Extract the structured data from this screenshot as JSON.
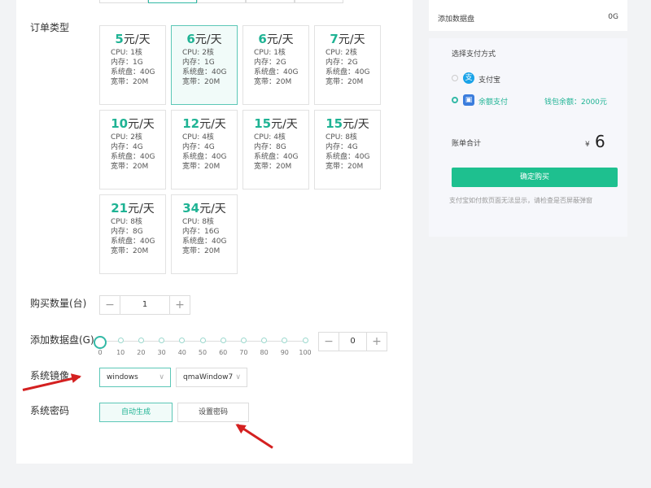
{
  "order_type_label": "订单类型",
  "plans": [
    {
      "price": "5",
      "unit": "元/天",
      "cpu": "CPU: 1核",
      "mem": "内存：1G",
      "disk": "系统盘：40G",
      "bw": "宽带：20M",
      "selected": false
    },
    {
      "price": "6",
      "unit": "元/天",
      "cpu": "CPU: 2核",
      "mem": "内存：1G",
      "disk": "系统盘：40G",
      "bw": "宽带：20M",
      "selected": true
    },
    {
      "price": "6",
      "unit": "元/天",
      "cpu": "CPU: 1核",
      "mem": "内存：2G",
      "disk": "系统盘：40G",
      "bw": "宽带：20M",
      "selected": false
    },
    {
      "price": "7",
      "unit": "元/天",
      "cpu": "CPU: 2核",
      "mem": "内存：2G",
      "disk": "系统盘：40G",
      "bw": "宽带：20M",
      "selected": false
    },
    {
      "price": "10",
      "unit": "元/天",
      "cpu": "CPU: 2核",
      "mem": "内存：4G",
      "disk": "系统盘：40G",
      "bw": "宽带：20M",
      "selected": false
    },
    {
      "price": "12",
      "unit": "元/天",
      "cpu": "CPU: 4核",
      "mem": "内存：4G",
      "disk": "系统盘：40G",
      "bw": "宽带：20M",
      "selected": false
    },
    {
      "price": "15",
      "unit": "元/天",
      "cpu": "CPU: 4核",
      "mem": "内存：8G",
      "disk": "系统盘：40G",
      "bw": "宽带：20M",
      "selected": false
    },
    {
      "price": "15",
      "unit": "元/天",
      "cpu": "CPU: 8核",
      "mem": "内存：4G",
      "disk": "系统盘：40G",
      "bw": "宽带：20M",
      "selected": false
    },
    {
      "price": "21",
      "unit": "元/天",
      "cpu": "CPU: 8核",
      "mem": "内存：8G",
      "disk": "系统盘：40G",
      "bw": "宽带：20M",
      "selected": false
    },
    {
      "price": "34",
      "unit": "元/天",
      "cpu": "CPU: 8核",
      "mem": "内存：16G",
      "disk": "系统盘：40G",
      "bw": "宽带：20M",
      "selected": false
    }
  ],
  "quantity": {
    "label": "购买数量(台)",
    "minus": "−",
    "value": "1",
    "plus": "+"
  },
  "data_disk": {
    "label": "添加数据盘(G)",
    "ticks": [
      "0",
      "10",
      "20",
      "30",
      "40",
      "50",
      "60",
      "70",
      "80",
      "90",
      "100"
    ],
    "slider_value": 0,
    "minus": "−",
    "value": "0",
    "plus": "+"
  },
  "image": {
    "label": "系统镜像",
    "os": "windows",
    "version": "qmaWindow7"
  },
  "password": {
    "label": "系统密码",
    "auto": "自动生成",
    "manual": "设置密码"
  },
  "side": {
    "data_disk_label": "添加数据盘",
    "data_disk_value": "0G",
    "pay_method_label": "选择支付方式",
    "alipay": "支付宝",
    "balance": "余额支付",
    "wallet_balance": "钱包余额：2000元",
    "total_label": "账单合计",
    "currency": "¥",
    "total": "6",
    "confirm": "确定购买",
    "hint": "支付宝如付款页面无法显示，请检查是否屏蔽弹窗"
  },
  "colors": {
    "accent": "#1ec08f",
    "arrow": "#d42020"
  }
}
